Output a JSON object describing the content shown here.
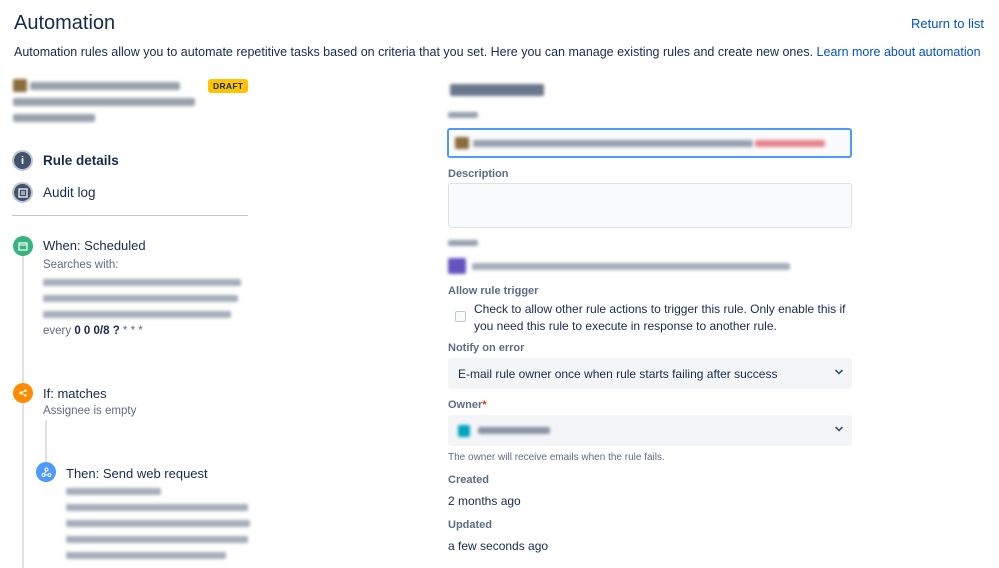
{
  "header": {
    "title": "Automation",
    "return_link": "Return to list",
    "intro_text": "Automation rules allow you to automate repetitive tasks based on criteria that you set. Here you can manage existing rules and create new ones.",
    "learn_more": "Learn more about automation"
  },
  "rule": {
    "status_badge": "DRAFT"
  },
  "nav": {
    "rule_details": "Rule details",
    "audit_log": "Audit log"
  },
  "timeline": {
    "when_title": "When: Scheduled",
    "when_sub": "Searches with:",
    "cron_prefix": "every",
    "cron_bold": "0 0 0/8 ?",
    "cron_suffix": " * * *",
    "if_title": "If: matches",
    "if_sub": "Assignee is empty",
    "then_title": "Then: Send web request"
  },
  "details": {
    "description_label": "Description",
    "allow_trigger_label": "Allow rule trigger",
    "allow_trigger_text": "Check to allow other rule actions to trigger this rule. Only enable this if you need this rule to execute in response to another rule.",
    "notify_label": "Notify on error",
    "notify_value": "E-mail rule owner once when rule starts failing after success",
    "owner_label": "Owner",
    "owner_required": "*",
    "owner_hint": "The owner will receive emails when the rule fails.",
    "created_label": "Created",
    "created_value": "2 months ago",
    "updated_label": "Updated",
    "updated_value": "a few seconds ago"
  },
  "colors": {
    "link": "#0052cc",
    "focus_border": "#4c9aff",
    "draft_badge": "#ffc400",
    "when_icon": "#36b37e",
    "if_icon": "#ff8b00",
    "then_icon": "#4c9aff"
  }
}
